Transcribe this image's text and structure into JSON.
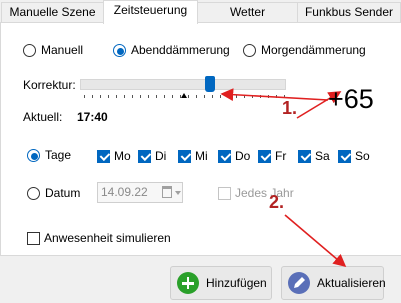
{
  "tabs": [
    "Manuelle Szene",
    "Zeitsteuerung",
    "Wetter",
    "Funkbus Sender"
  ],
  "mode": {
    "options": [
      "Manuell",
      "Abenddämmerung",
      "Morgendämmerung"
    ],
    "selected": "Abenddämmerung"
  },
  "korrektur": {
    "label": "Korrektur:",
    "value": "+65"
  },
  "aktuell": {
    "label": "Aktuell:",
    "value": "17:40"
  },
  "tage": {
    "label": "Tage",
    "selected": true,
    "days": [
      "Mo",
      "Di",
      "Mi",
      "Do",
      "Fr",
      "Sa",
      "So"
    ],
    "checked": [
      true,
      true,
      true,
      true,
      true,
      true,
      true
    ]
  },
  "datum": {
    "label": "Datum",
    "value": "14.09.22",
    "jedes_jahr": "Jedes Jahr"
  },
  "anwesenheit": "Anwesenheit simulieren",
  "buttons": {
    "add": "Hinzufügen",
    "update": "Aktualisieren"
  },
  "annotations": [
    "1.",
    "2."
  ],
  "colors": {
    "accent": "#0067c0",
    "arrow": "#e02020",
    "annotation": "#b22222"
  }
}
